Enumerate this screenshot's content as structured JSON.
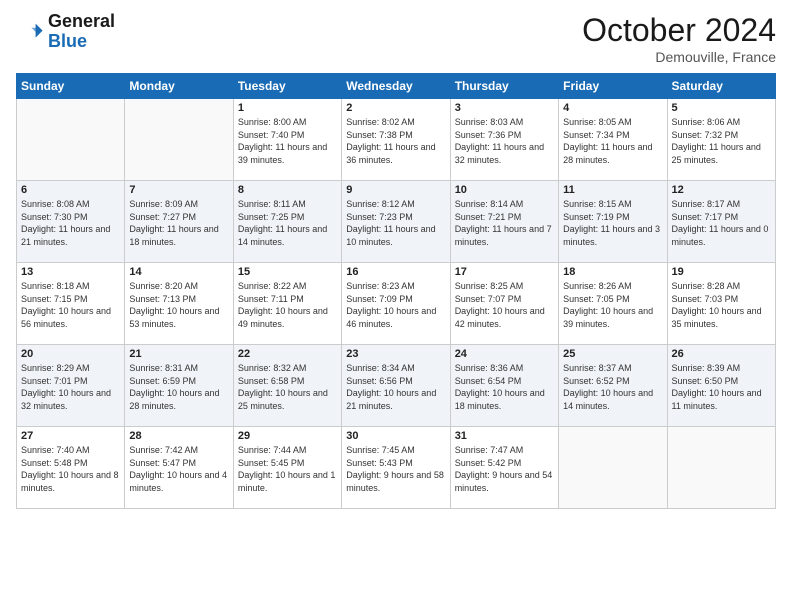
{
  "logo": {
    "line1": "General",
    "line2": "Blue"
  },
  "title": "October 2024",
  "location": "Demouville, France",
  "days_header": [
    "Sunday",
    "Monday",
    "Tuesday",
    "Wednesday",
    "Thursday",
    "Friday",
    "Saturday"
  ],
  "weeks": [
    [
      {
        "day": "",
        "info": ""
      },
      {
        "day": "",
        "info": ""
      },
      {
        "day": "1",
        "info": "Sunrise: 8:00 AM\nSunset: 7:40 PM\nDaylight: 11 hours and 39 minutes."
      },
      {
        "day": "2",
        "info": "Sunrise: 8:02 AM\nSunset: 7:38 PM\nDaylight: 11 hours and 36 minutes."
      },
      {
        "day": "3",
        "info": "Sunrise: 8:03 AM\nSunset: 7:36 PM\nDaylight: 11 hours and 32 minutes."
      },
      {
        "day": "4",
        "info": "Sunrise: 8:05 AM\nSunset: 7:34 PM\nDaylight: 11 hours and 28 minutes."
      },
      {
        "day": "5",
        "info": "Sunrise: 8:06 AM\nSunset: 7:32 PM\nDaylight: 11 hours and 25 minutes."
      }
    ],
    [
      {
        "day": "6",
        "info": "Sunrise: 8:08 AM\nSunset: 7:30 PM\nDaylight: 11 hours and 21 minutes."
      },
      {
        "day": "7",
        "info": "Sunrise: 8:09 AM\nSunset: 7:27 PM\nDaylight: 11 hours and 18 minutes."
      },
      {
        "day": "8",
        "info": "Sunrise: 8:11 AM\nSunset: 7:25 PM\nDaylight: 11 hours and 14 minutes."
      },
      {
        "day": "9",
        "info": "Sunrise: 8:12 AM\nSunset: 7:23 PM\nDaylight: 11 hours and 10 minutes."
      },
      {
        "day": "10",
        "info": "Sunrise: 8:14 AM\nSunset: 7:21 PM\nDaylight: 11 hours and 7 minutes."
      },
      {
        "day": "11",
        "info": "Sunrise: 8:15 AM\nSunset: 7:19 PM\nDaylight: 11 hours and 3 minutes."
      },
      {
        "day": "12",
        "info": "Sunrise: 8:17 AM\nSunset: 7:17 PM\nDaylight: 11 hours and 0 minutes."
      }
    ],
    [
      {
        "day": "13",
        "info": "Sunrise: 8:18 AM\nSunset: 7:15 PM\nDaylight: 10 hours and 56 minutes."
      },
      {
        "day": "14",
        "info": "Sunrise: 8:20 AM\nSunset: 7:13 PM\nDaylight: 10 hours and 53 minutes."
      },
      {
        "day": "15",
        "info": "Sunrise: 8:22 AM\nSunset: 7:11 PM\nDaylight: 10 hours and 49 minutes."
      },
      {
        "day": "16",
        "info": "Sunrise: 8:23 AM\nSunset: 7:09 PM\nDaylight: 10 hours and 46 minutes."
      },
      {
        "day": "17",
        "info": "Sunrise: 8:25 AM\nSunset: 7:07 PM\nDaylight: 10 hours and 42 minutes."
      },
      {
        "day": "18",
        "info": "Sunrise: 8:26 AM\nSunset: 7:05 PM\nDaylight: 10 hours and 39 minutes."
      },
      {
        "day": "19",
        "info": "Sunrise: 8:28 AM\nSunset: 7:03 PM\nDaylight: 10 hours and 35 minutes."
      }
    ],
    [
      {
        "day": "20",
        "info": "Sunrise: 8:29 AM\nSunset: 7:01 PM\nDaylight: 10 hours and 32 minutes."
      },
      {
        "day": "21",
        "info": "Sunrise: 8:31 AM\nSunset: 6:59 PM\nDaylight: 10 hours and 28 minutes."
      },
      {
        "day": "22",
        "info": "Sunrise: 8:32 AM\nSunset: 6:58 PM\nDaylight: 10 hours and 25 minutes."
      },
      {
        "day": "23",
        "info": "Sunrise: 8:34 AM\nSunset: 6:56 PM\nDaylight: 10 hours and 21 minutes."
      },
      {
        "day": "24",
        "info": "Sunrise: 8:36 AM\nSunset: 6:54 PM\nDaylight: 10 hours and 18 minutes."
      },
      {
        "day": "25",
        "info": "Sunrise: 8:37 AM\nSunset: 6:52 PM\nDaylight: 10 hours and 14 minutes."
      },
      {
        "day": "26",
        "info": "Sunrise: 8:39 AM\nSunset: 6:50 PM\nDaylight: 10 hours and 11 minutes."
      }
    ],
    [
      {
        "day": "27",
        "info": "Sunrise: 7:40 AM\nSunset: 5:48 PM\nDaylight: 10 hours and 8 minutes."
      },
      {
        "day": "28",
        "info": "Sunrise: 7:42 AM\nSunset: 5:47 PM\nDaylight: 10 hours and 4 minutes."
      },
      {
        "day": "29",
        "info": "Sunrise: 7:44 AM\nSunset: 5:45 PM\nDaylight: 10 hours and 1 minute."
      },
      {
        "day": "30",
        "info": "Sunrise: 7:45 AM\nSunset: 5:43 PM\nDaylight: 9 hours and 58 minutes."
      },
      {
        "day": "31",
        "info": "Sunrise: 7:47 AM\nSunset: 5:42 PM\nDaylight: 9 hours and 54 minutes."
      },
      {
        "day": "",
        "info": ""
      },
      {
        "day": "",
        "info": ""
      }
    ]
  ]
}
